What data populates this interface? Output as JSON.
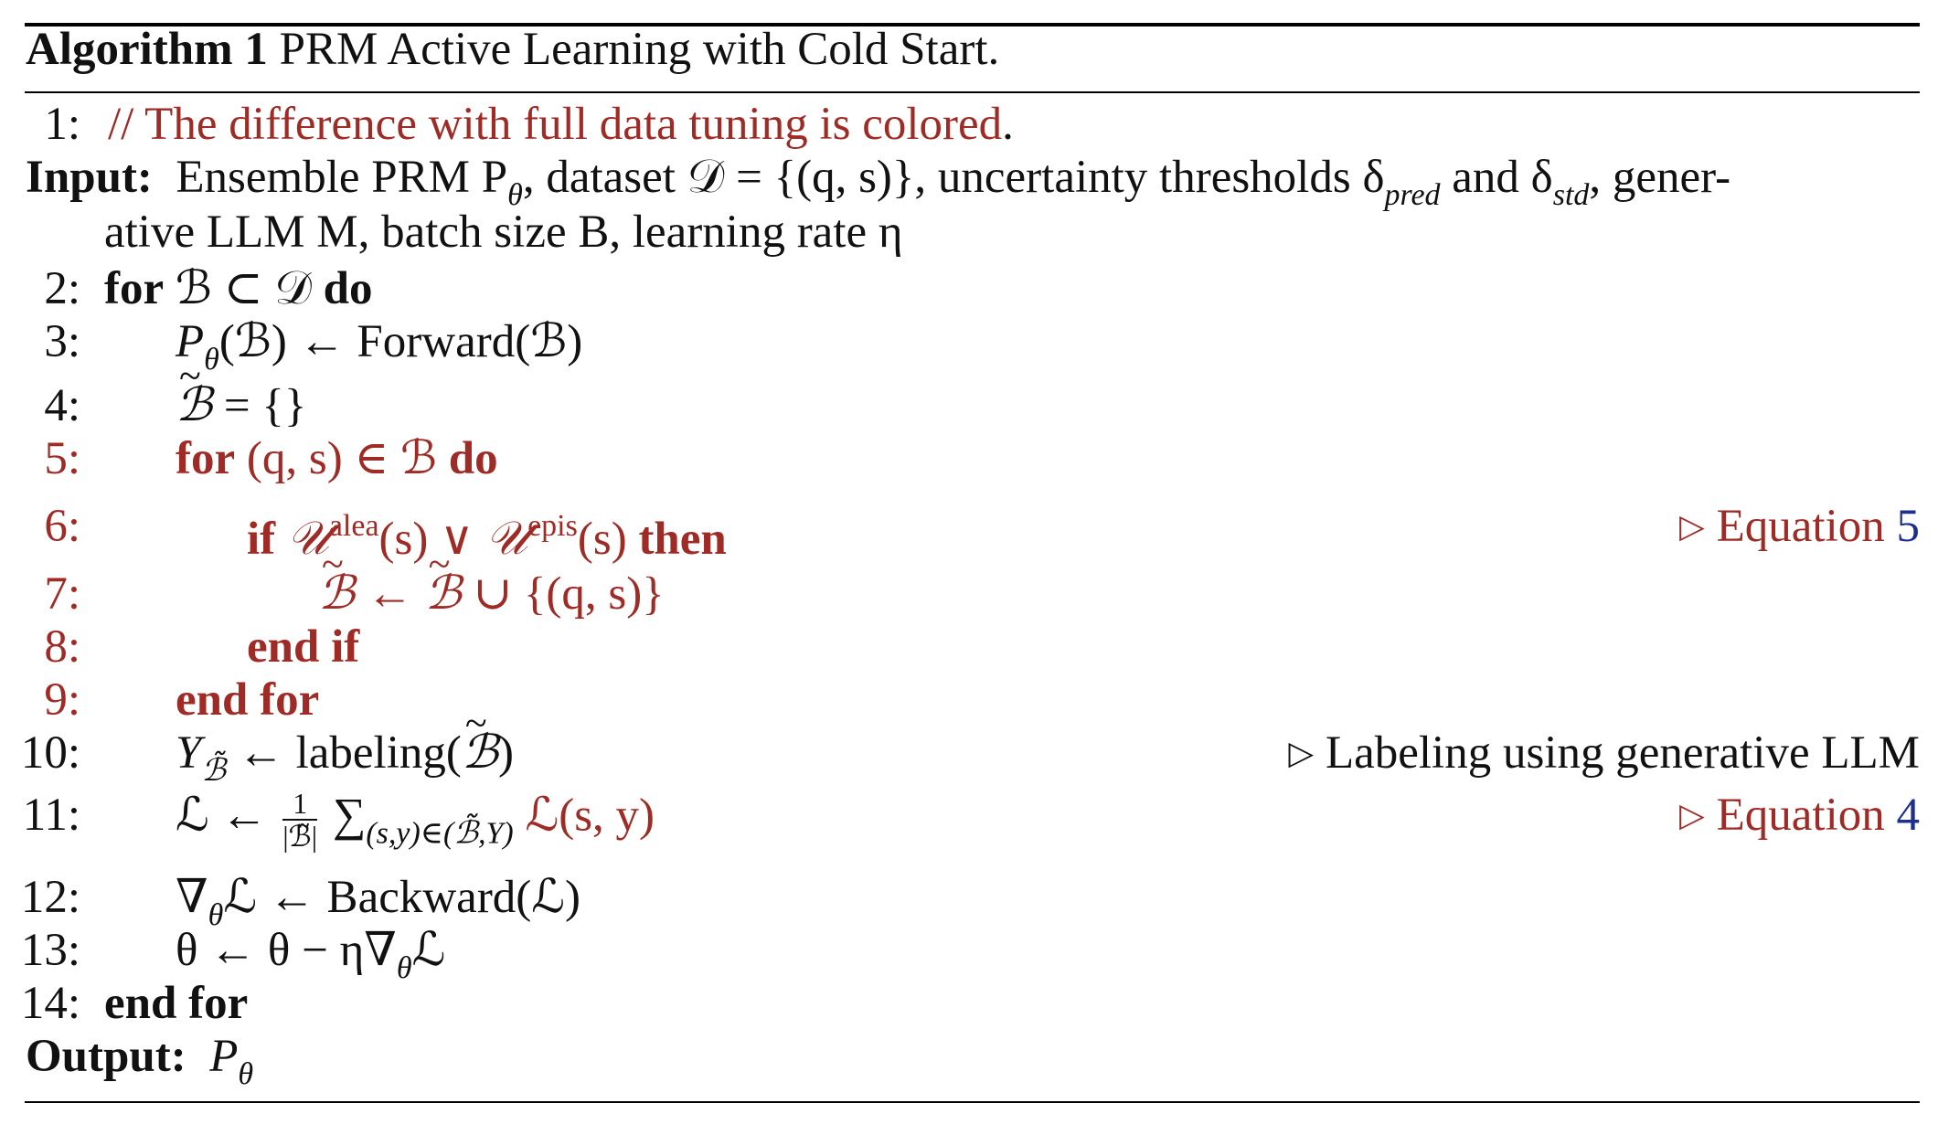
{
  "title": {
    "label": "Algorithm 1",
    "name": "PRM Active Learning with Cold Start."
  },
  "lines": {
    "l1": {
      "num": "1:",
      "text": "// The difference with full data tuning is colored",
      "end": "."
    },
    "input": {
      "label": "Input:",
      "text1": "Ensemble PRM P",
      "text2": ", dataset 𝒟 = {(q, s)}, uncertainty thresholds δ",
      "sub_pred": "pred",
      "text3": " and δ",
      "sub_std": "std",
      "text4": ", gener-",
      "text5": "ative LLM M, batch size B, learning rate η"
    },
    "l2": {
      "num": "2:",
      "kw": "for",
      "expr": " ℬ ⊂ 𝒟 ",
      "kw2": "do"
    },
    "l3": {
      "num": "3:",
      "expr": "(ℬ) ← Forward(ℬ)"
    },
    "l4": {
      "num": "4:",
      "expr": " = {}"
    },
    "l5": {
      "num": "5:",
      "kw": "for",
      "expr": " (q, s) ∈ ℬ ",
      "kw2": "do"
    },
    "l6": {
      "num": "6:",
      "kw": "if",
      "sup1": "alea",
      "sup2": "epis",
      "kw2": "then",
      "comment": "Equation ",
      "ref": "5"
    },
    "l7": {
      "num": "7:",
      "expr": " ∪ {(q, s)}"
    },
    "l8": {
      "num": "8:",
      "kw": "end if"
    },
    "l9": {
      "num": "9:",
      "kw": "end for"
    },
    "l10": {
      "num": "10:",
      "expr": "labeling(",
      "comment": "Labeling using generative LLM"
    },
    "l11": {
      "num": "11:",
      "frac_num": "1",
      "sumsub": "(s,y)∈(",
      "expr": "ℒ(s, y)",
      "comment": "Equation ",
      "ref": "4"
    },
    "l12": {
      "num": "12:",
      "expr": "ℒ ← Backward(ℒ)"
    },
    "l13": {
      "num": "13:",
      "expr": "θ ← θ − η∇",
      "expr2": "ℒ"
    },
    "l14": {
      "num": "14:",
      "kw": "end for"
    },
    "output": {
      "label": "Output:",
      "text": "P"
    }
  },
  "colors": {
    "highlight": "#9e2b25",
    "link": "#1f2f8f"
  }
}
